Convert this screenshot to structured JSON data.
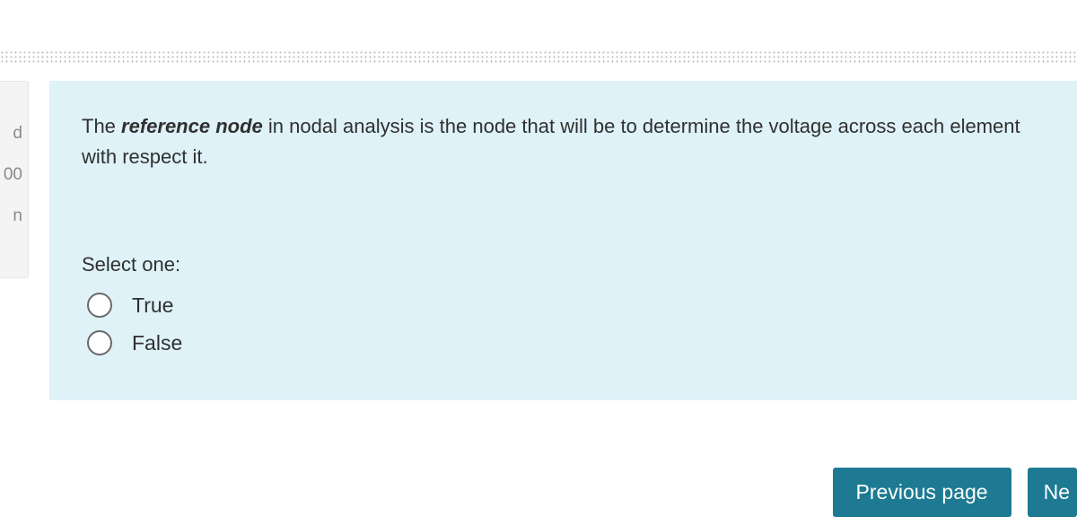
{
  "sidebar": {
    "frag1": "d",
    "frag2": "00",
    "frag3": "n"
  },
  "question": {
    "pre": "The ",
    "emph": "reference node",
    "post": " in nodal analysis is the node that will be to determine the voltage across each element with respect it."
  },
  "answer": {
    "prompt": "Select one:",
    "options": [
      "True",
      "False"
    ]
  },
  "nav": {
    "prev": "Previous page",
    "next": "Ne"
  }
}
